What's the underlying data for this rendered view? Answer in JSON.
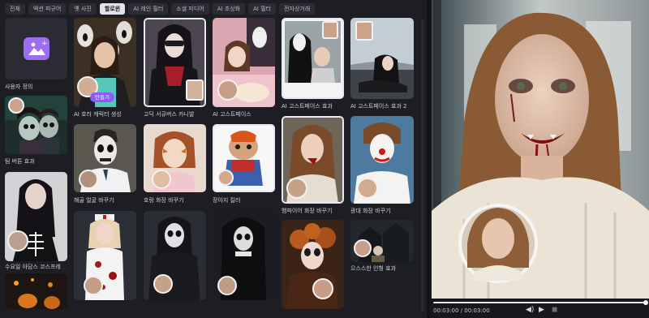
{
  "tabs": [
    {
      "label": "전체",
      "active": false
    },
    {
      "label": "액션 피규어",
      "active": false
    },
    {
      "label": "옛 사진",
      "active": false
    },
    {
      "label": "할로윈",
      "active": true
    },
    {
      "label": "AI 레인 필터",
      "active": false
    },
    {
      "label": "소셜 미디어",
      "active": false
    },
    {
      "label": "AI 초상화",
      "active": false
    },
    {
      "label": "AI 필터",
      "active": false
    },
    {
      "label": "전자상거래",
      "active": false
    }
  ],
  "cards": {
    "custom": "사용자 정의",
    "tim_burton": "팀 버튼 효과",
    "wednesday": "수요일 아담스 코스프레",
    "horror_character": "AI 호러 캐릭터 생성",
    "make_button": "만들기",
    "skull_face": "해골 얼굴 바꾸기",
    "gothic_carnival": "고딕 서큐버스 카니발",
    "tiger_makeup": "호랑 화장 바꾸기",
    "ghostface": "AI 고스트페이스",
    "doll_killer": "장아지 킬러",
    "ghostface_effect": "AI 고스트페이스 효과",
    "vampire_makeup": "뱀파이어 화장 바꾸기",
    "ghostface_effect2": "AI 고스트페이스 효과 2",
    "clown_makeup": "광대 화장 바꾸기",
    "eerie_doll": "으스스한 인형 효과"
  },
  "player": {
    "time": "00:03:00 / 00:03:00",
    "progress": 1.0
  },
  "colors": {
    "accent": "#8a5cf6",
    "panel": "#1d1e24",
    "blood": "#9b0f12"
  }
}
